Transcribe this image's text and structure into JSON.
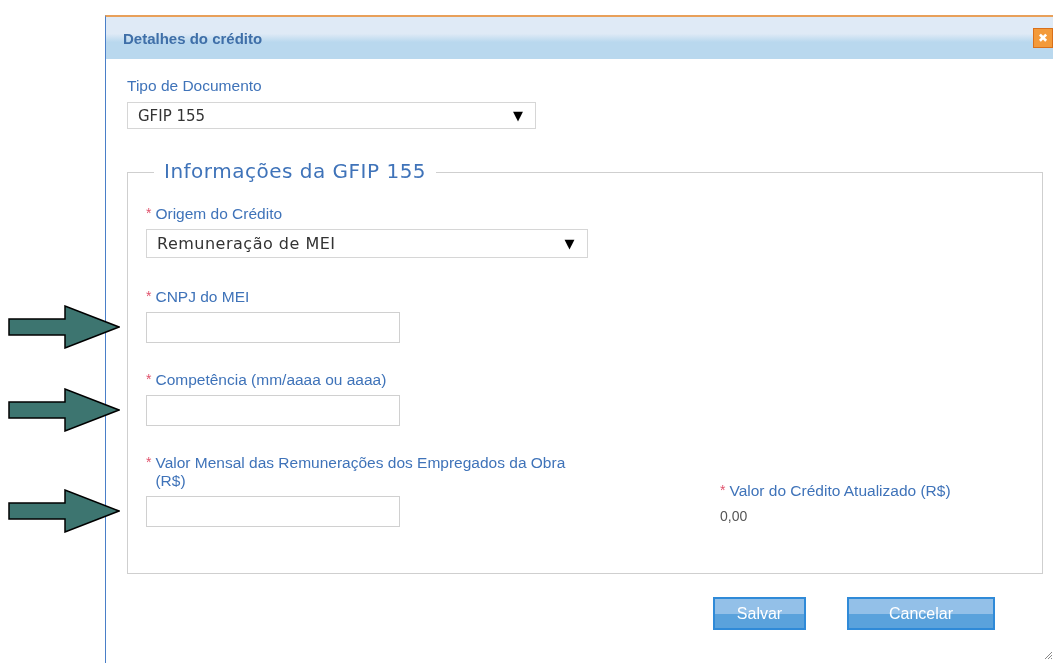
{
  "dialog": {
    "title": "Detalhes do crédito",
    "close": "✖"
  },
  "document_type": {
    "label": "Tipo de Documento",
    "value": "GFIP 155",
    "caret": "▼"
  },
  "section": {
    "legend": "Informações da GFIP 155",
    "origin": {
      "required_mark": "*",
      "label": "Origem do Crédito",
      "value": "Remuneração de MEI",
      "caret": "▼"
    },
    "fields": [
      {
        "required_mark": "*",
        "label": "CNPJ do MEI",
        "annotated": true
      },
      {
        "required_mark": "*",
        "label": "Competência (mm/aaaa ou aaaa)",
        "annotated": true
      },
      {
        "required_mark": "*",
        "label": "Valor Mensal das Remunerações dos Empregados da Obra (R$)",
        "annotated": true
      }
    ],
    "total": {
      "required_mark": "*",
      "label": "Valor do Crédito Atualizado (R$)",
      "value": "0,00"
    }
  },
  "buttons": [
    "Salvar",
    "Cancelar"
  ]
}
